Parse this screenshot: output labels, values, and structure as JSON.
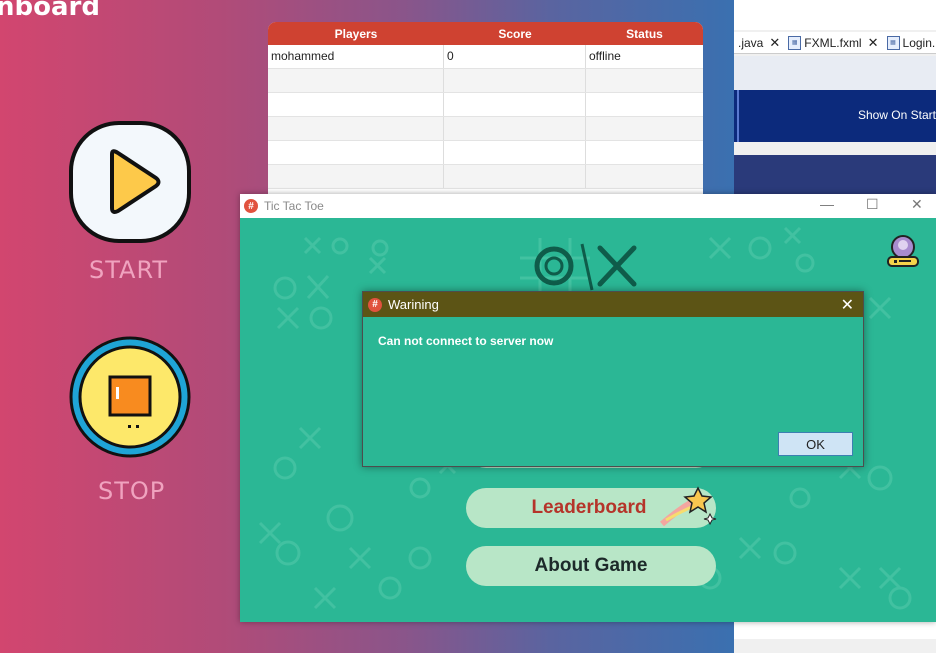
{
  "server": {
    "title": "nboard",
    "start_label": "START",
    "stop_label": "STOP"
  },
  "players_table": {
    "headers": [
      "Players",
      "Score",
      "Status"
    ],
    "rows": [
      [
        "mohammed",
        "0",
        "offline"
      ],
      [
        "",
        "",
        ""
      ],
      [
        "",
        "",
        ""
      ],
      [
        "",
        "",
        ""
      ],
      [
        "",
        "",
        ""
      ],
      [
        "",
        "",
        ""
      ]
    ]
  },
  "ide": {
    "tabs": [
      {
        "label": ".java"
      },
      {
        "label": "FXML.fxml"
      },
      {
        "label": "Login."
      }
    ],
    "banner_text": "Show On Start"
  },
  "ttt_window": {
    "title": "Tic Tac Toe",
    "buttons": {
      "leaderboard": "Leaderboard",
      "about": "About Game"
    },
    "colors": {
      "background": "#2bb795",
      "button": "#b8e6c7",
      "leaderboard_text": "#b5342a"
    }
  },
  "dialog": {
    "title": "Warining",
    "message": "Can not connect to server now",
    "ok_label": "OK"
  },
  "icons": [
    "play-icon",
    "stop-icon",
    "ox-logo-icon",
    "avatar-icon",
    "star-icon",
    "app-icon",
    "close-icon",
    "minimize-icon",
    "maximize-icon"
  ]
}
